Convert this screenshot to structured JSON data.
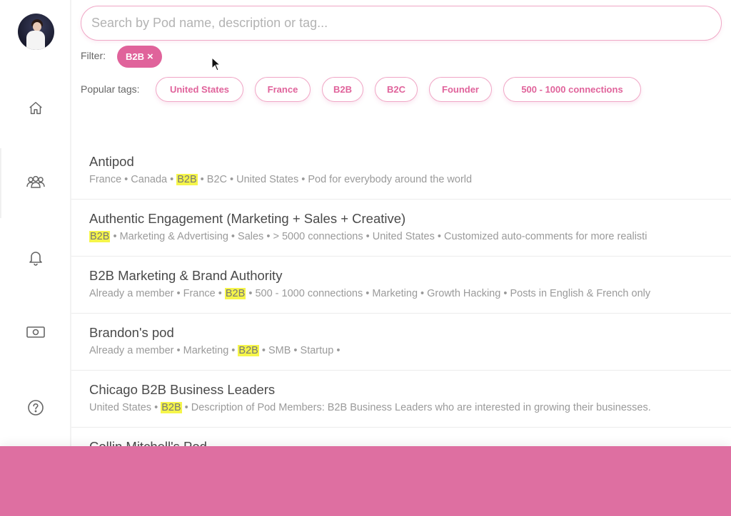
{
  "search": {
    "placeholder": "Search by Pod name, description or tag..."
  },
  "filter": {
    "label": "Filter:",
    "active_chip": "B2B",
    "remove_icon": "×"
  },
  "popular": {
    "label": "Popular tags:",
    "tags": [
      "United States",
      "France",
      "B2B",
      "B2C",
      "Founder",
      "500 - 1000 connections"
    ]
  },
  "sidebar": {
    "icons": [
      "home-icon",
      "people-icon",
      "bell-icon",
      "money-icon",
      "help-icon"
    ]
  },
  "highlight_term": "B2B",
  "pods": [
    {
      "name": "Antipod",
      "meta": [
        "France",
        "Canada",
        "B2B",
        "B2C",
        "United States",
        "Pod for everybody around the world"
      ]
    },
    {
      "name": "Authentic Engagement (Marketing + Sales + Creative)",
      "meta": [
        "B2B",
        "Marketing & Advertising",
        "Sales",
        "> 5000 connections",
        "United States",
        "Customized auto-comments for more realisti"
      ]
    },
    {
      "name": "B2B Marketing & Brand Authority",
      "meta": [
        "Already a member",
        "France",
        "B2B",
        "500 - 1000 connections",
        "Marketing",
        "Growth Hacking",
        "Posts in English & French only"
      ]
    },
    {
      "name": "Brandon's pod",
      "meta": [
        "Already a member",
        "Marketing",
        "B2B",
        "SMB",
        "Startup",
        ""
      ]
    },
    {
      "name": "Chicago B2B Business Leaders",
      "meta": [
        "United States",
        "B2B",
        "Description of Pod Members: B2B Business Leaders who are interested in growing their businesses."
      ]
    },
    {
      "name": "Collin Mitchell's Pod",
      "meta": []
    }
  ],
  "colors": {
    "accent": "#e0639b",
    "accent_border": "#f0a7c6",
    "highlight": "#f5f54a",
    "bottom_bar": "#de6fa1"
  }
}
